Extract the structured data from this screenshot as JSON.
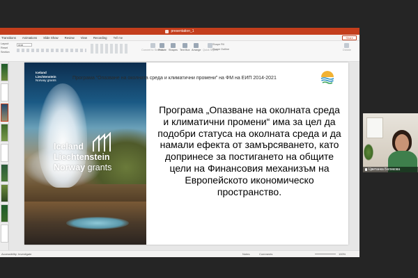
{
  "app": {
    "title": "presentation_1",
    "menu": [
      "Transitions",
      "Animations",
      "Slide Show",
      "Review",
      "View",
      "Recording",
      "Tell me"
    ],
    "share_label": "Share"
  },
  "ribbon": {
    "font_name": "Arial",
    "left_items": [
      "Layout",
      "Reset",
      "Section"
    ],
    "buttons": [
      "Picture",
      "Shapes",
      "Text Box",
      "Arrange",
      "Quick Styles"
    ],
    "right_items": [
      "Shape Fill",
      "Shape Outline"
    ],
    "faded": [
      "Convert to SmartArt",
      "Dictate"
    ]
  },
  "slide": {
    "title": "Програма “Опазване на околната среда и климатични промени” на ФМ на ЕИП 2014-2021",
    "body": "Програма „Опазване на околната среда и климатични промени“ има за цел да подобри статуса на околната среда и да намали ефекта от замърсяването, като допринесе за постигането на общите цели на Финансовия механизъм на Европейското икономическо пространство.",
    "logo_small": [
      "Iceland",
      "Liechtenstein",
      "Norway grants"
    ],
    "logo_big": {
      "line1": "Iceland",
      "line2": "Liechtenstein",
      "line3_a": "Norway",
      "line3_b": " grants"
    }
  },
  "status": {
    "accessibility": "Accessibility: Investigate",
    "notes": "Notes",
    "comments": "Comments",
    "zoom": "100%"
  },
  "participant": {
    "name": "Цветанка Беликова"
  },
  "colors": {
    "ppt_accent": "#c43e1c",
    "background": "#252525"
  }
}
